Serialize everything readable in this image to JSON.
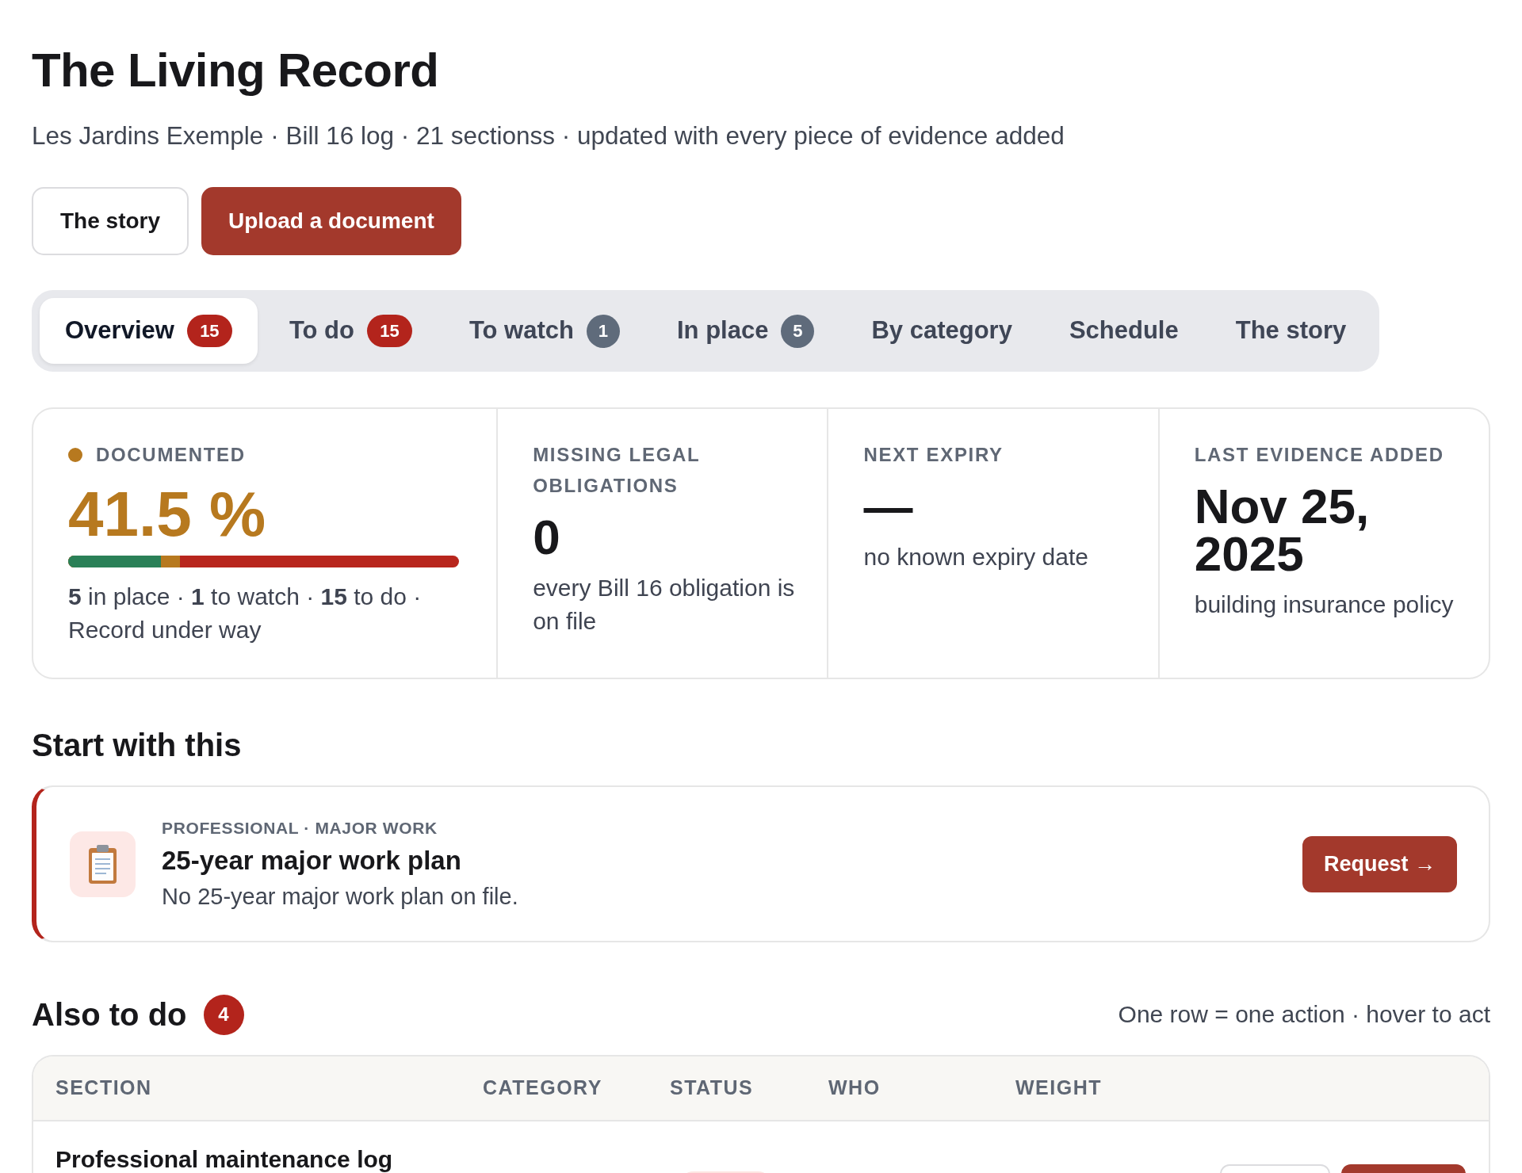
{
  "header": {
    "title": "The Living Record",
    "subtitle": "Les Jardins Exemple · Bill 16 log · 21 sectionss · updated with every piece of evidence added"
  },
  "actions": [
    {
      "label": "The story",
      "kind": "secondary"
    },
    {
      "label": "Upload a document",
      "kind": "primary"
    }
  ],
  "tabs": [
    {
      "label": "Overview",
      "selected": true,
      "badge": {
        "text": "15",
        "kind": "alert"
      }
    },
    {
      "label": "To do",
      "selected": false,
      "badge": {
        "text": "15",
        "kind": "alert"
      }
    },
    {
      "label": "To watch",
      "selected": false,
      "badge": {
        "text": "1",
        "kind": "neutral"
      }
    },
    {
      "label": "In place",
      "selected": false,
      "badge": {
        "text": "5",
        "kind": "neutral"
      }
    },
    {
      "label": "By category",
      "selected": false
    },
    {
      "label": "Schedule",
      "selected": false
    },
    {
      "label": "The story",
      "selected": false
    }
  ],
  "stats": [
    {
      "kind": "progress",
      "label": "DOCUMENTED",
      "color": "#b7791f",
      "value": "41.5 %",
      "bar": {
        "color": "#b8261d",
        "segments": [
          {
            "level": 0.286,
            "color": "#b7791f"
          },
          {
            "level": 0.238,
            "color": "#2a8057"
          }
        ]
      },
      "note": "**5** in place · **1** to watch · **15** to do · Record under way"
    },
    {
      "kind": "figure",
      "label": "MISSING LEGAL OBLIGATIONS",
      "value": "0",
      "note": "every Bill 16 obligation is on file"
    },
    {
      "kind": "figure",
      "label": "NEXT EXPIRY",
      "value": "—",
      "note": "no known expiry date"
    },
    {
      "kind": "figure",
      "label": "LAST EVIDENCE ADDED",
      "value": "Nov 25, 2025",
      "note": "building insurance policy"
    }
  ],
  "start_with": {
    "heading": "Start with this",
    "card": {
      "eyebrow": "PROFESSIONAL · MAJOR WORK",
      "title": "25-year major work plan",
      "description": "No 25-year major work plan on file.",
      "action": "Request →"
    }
  },
  "also_to_do": {
    "heading": "Also to do",
    "count": "4",
    "hint": "One row = one action · hover to act",
    "table": {
      "columns": [
        "SECTION",
        "CATEGORY",
        "STATUS",
        "WHO",
        "WEIGHT"
      ],
      "rows": [
        {
          "section": "Professional maintenance log",
          "status_badge": true,
          "actions": [
            {
              "kind": "secondary"
            },
            {
              "kind": "primary"
            }
          ]
        }
      ]
    }
  }
}
